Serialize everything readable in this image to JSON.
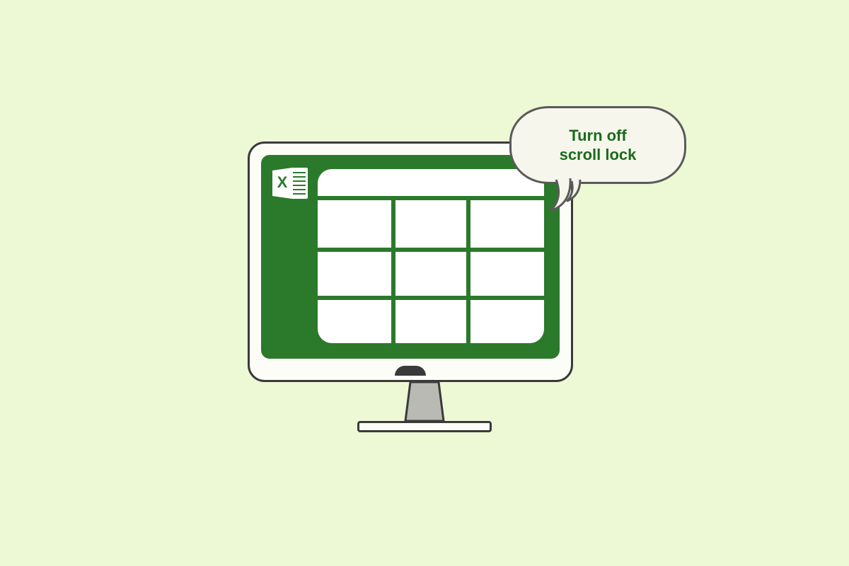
{
  "bubble": {
    "text": "Turn off\nscroll lock"
  },
  "icon": {
    "letter": "X"
  },
  "colors": {
    "background": "#edf8d5",
    "screen": "#2b7a2b",
    "bubble_fill": "#f6f6ed",
    "bubble_text": "#1a6b1a",
    "outline": "#3a3a3a"
  }
}
